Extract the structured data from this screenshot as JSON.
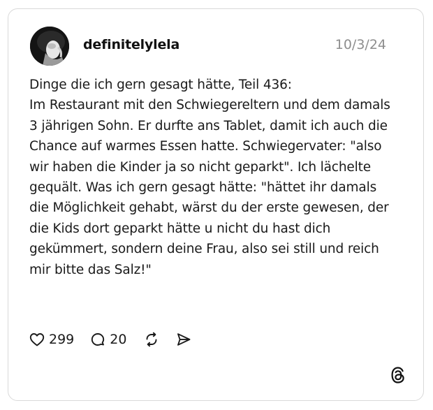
{
  "post": {
    "username": "definitelylela",
    "date": "10/3/24",
    "text": "Dinge die ich gern gesagt hätte, Teil 436:\nIm Restaurant mit den Schwiegereltern und dem damals 3 jährigen Sohn. Er durfte ans Tablet, damit ich auch die Chance auf warmes Essen hatte. Schwiegervater: \"also wir haben die Kinder ja so nicht geparkt\". Ich lächelte gequält. Was ich gern gesagt hätte: \"hättet ihr damals die Möglichkeit gehabt, wärst du der erste gewesen, der die Kids dort geparkt hätte u nicht du hast dich gekümmert, sondern deine Frau, also sei still und reich mir bitte das Salz!\""
  },
  "actions": {
    "likes": "299",
    "replies": "20"
  },
  "icons": {
    "like": "heart-icon",
    "reply": "comment-icon",
    "repost": "repost-icon",
    "share": "send-icon",
    "brand": "threads-logo-icon"
  },
  "colors": {
    "text": "#1a1a1a",
    "muted": "#8e8e8e",
    "border": "#d9d9d9",
    "background": "#ffffff"
  }
}
